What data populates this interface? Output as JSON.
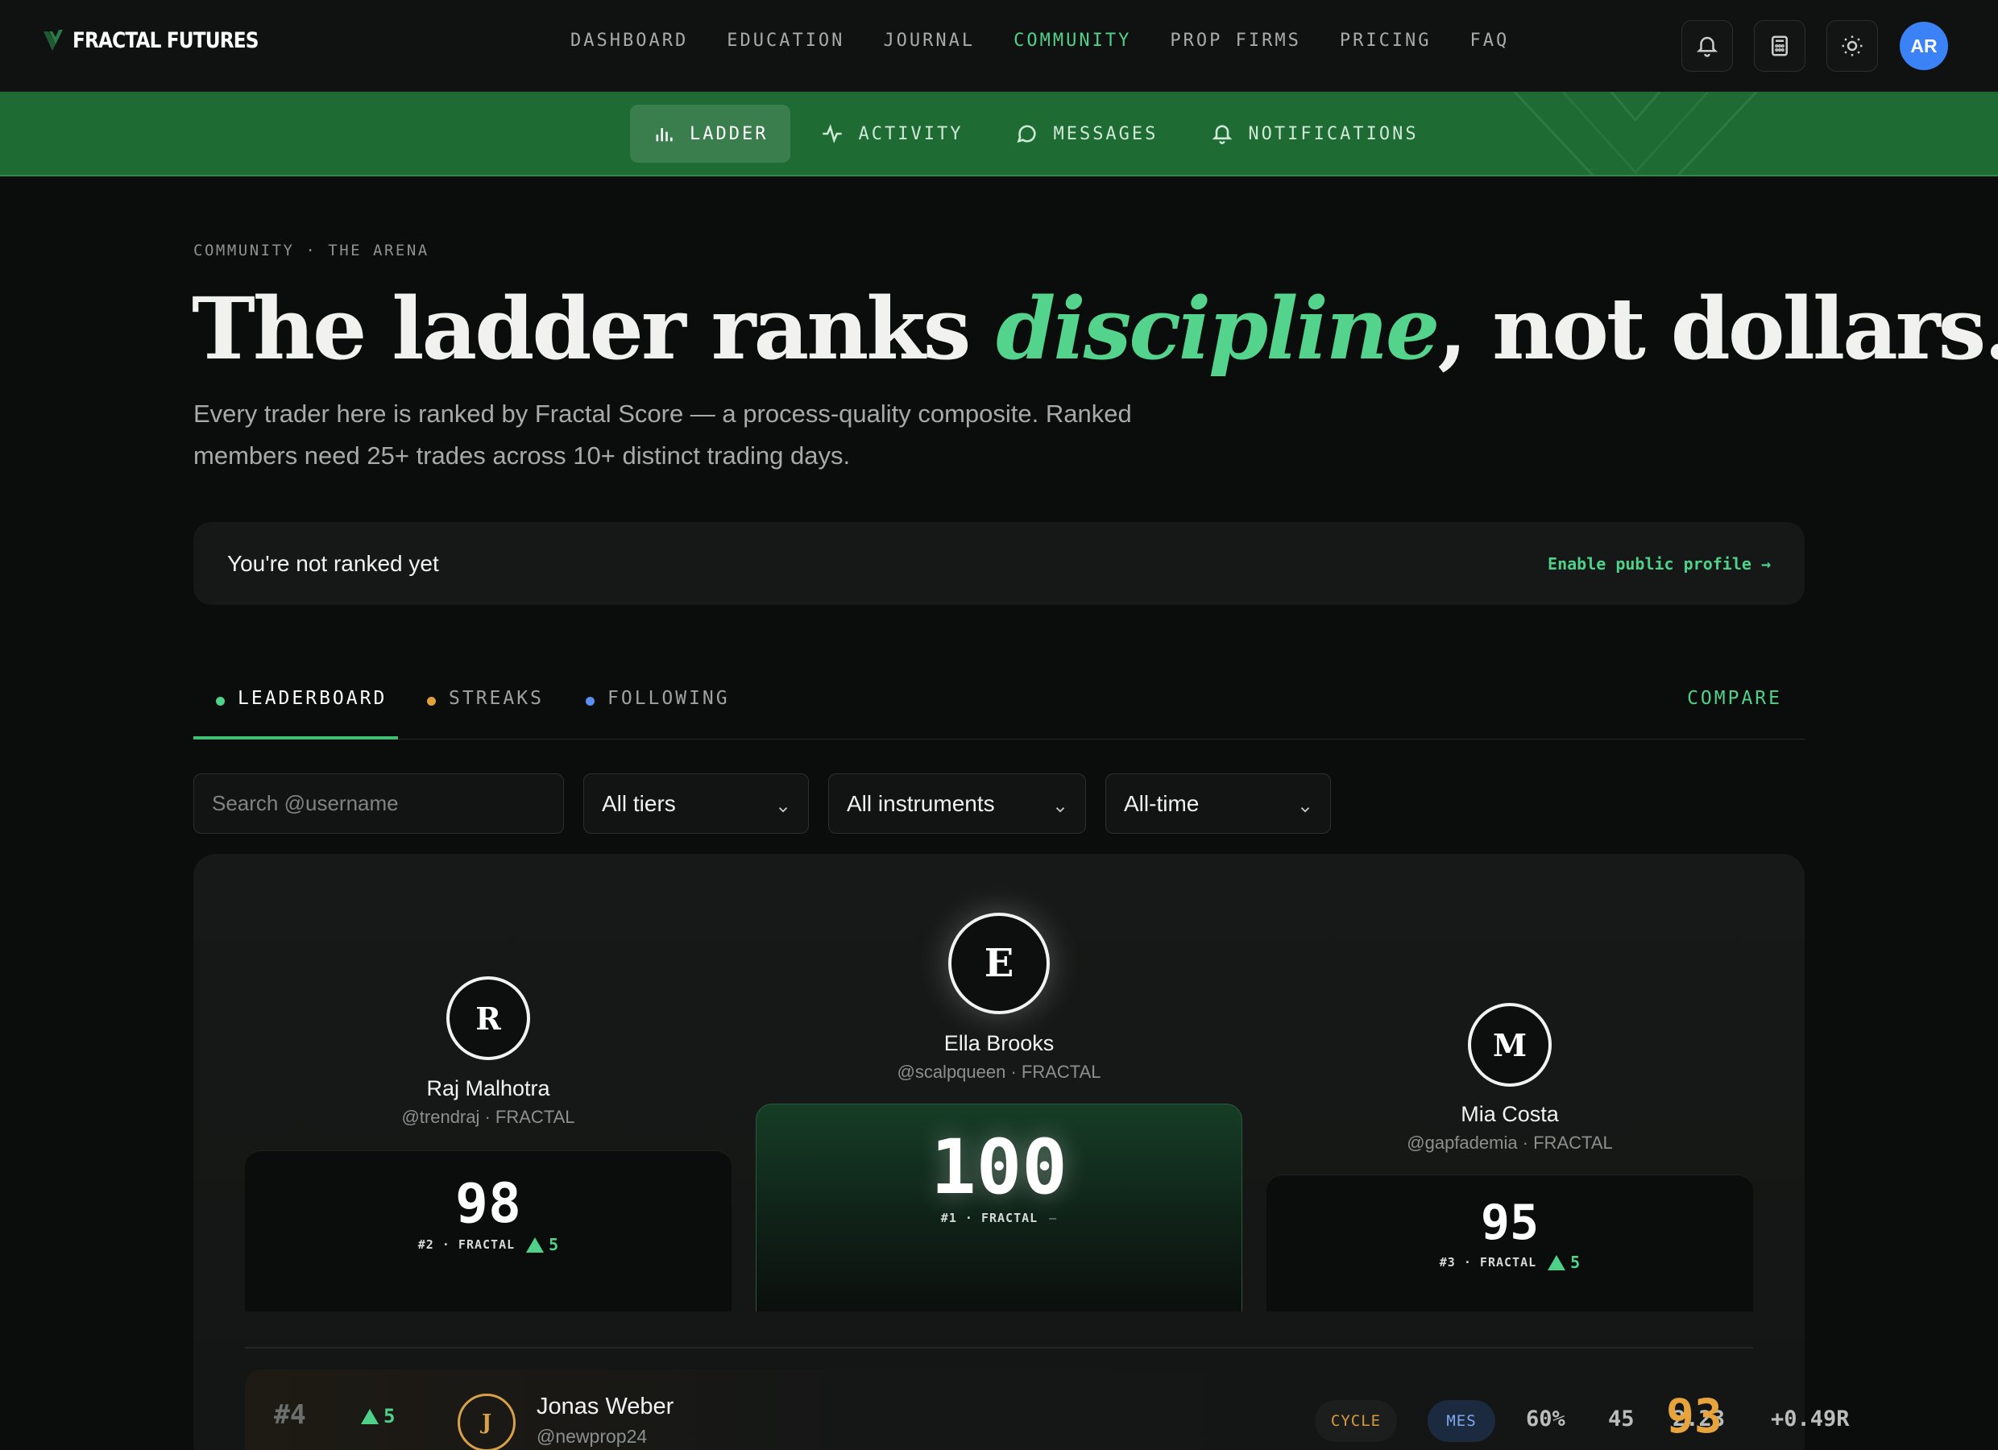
{
  "brand": {
    "name": "FRACTAL FUTURES",
    "logo_icon": "fractal-v-icon"
  },
  "nav": {
    "items": [
      {
        "label": "DASHBOARD",
        "active": false
      },
      {
        "label": "EDUCATION",
        "active": false
      },
      {
        "label": "JOURNAL",
        "active": false
      },
      {
        "label": "COMMUNITY",
        "active": true
      },
      {
        "label": "PROP FIRMS",
        "active": false
      },
      {
        "label": "PRICING",
        "active": false
      },
      {
        "label": "FAQ",
        "active": false
      }
    ],
    "actions": [
      {
        "icon": "bell-icon"
      },
      {
        "icon": "calculator-icon"
      },
      {
        "icon": "sun-icon"
      }
    ],
    "avatar_initials": "AR"
  },
  "subnav": {
    "tabs": [
      {
        "label": "LADDER",
        "icon": "bar-chart-icon",
        "active": true
      },
      {
        "label": "ACTIVITY",
        "icon": "pulse-icon",
        "active": false
      },
      {
        "label": "MESSAGES",
        "icon": "chat-bubble-icon",
        "active": false
      },
      {
        "label": "NOTIFICATIONS",
        "icon": "bell-icon",
        "active": false
      }
    ]
  },
  "hero": {
    "eyebrow": "COMMUNITY · THE ARENA",
    "headline_before": "The ladder ranks ",
    "headline_emphasis": "discipline",
    "headline_after": ", not dollars.",
    "lede": "Every trader here is ranked by Fractal Score — a process-quality composite. Ranked members need 25+ trades across 10+ distinct trading days."
  },
  "rank_banner": {
    "message": "You're not ranked yet",
    "link": "Enable public profile →"
  },
  "leaderboard_tabs": [
    {
      "label": "LEADERBOARD",
      "dot_color": "#4fd18a",
      "active": true
    },
    {
      "label": "STREAKS",
      "dot_color": "#e0a03c",
      "active": false
    },
    {
      "label": "FOLLOWING",
      "dot_color": "#5b8ff0",
      "active": false
    }
  ],
  "compare_label": "COMPARE",
  "filters": {
    "search_placeholder": "Search @username",
    "tier": "All tiers",
    "instrument": "All instruments",
    "period": "All-time"
  },
  "podium": [
    {
      "initial": "R",
      "name": "Raj Malhotra",
      "handle": "@trendraj · FRACTAL",
      "score": "98",
      "meta": "#2 · FRACTAL",
      "delta": "5"
    },
    {
      "initial": "E",
      "name": "Ella Brooks",
      "handle": "@scalpqueen · FRACTAL",
      "score": "100",
      "meta": "#1 · FRACTAL",
      "delta": "—"
    },
    {
      "initial": "M",
      "name": "Mia Costa",
      "handle": "@gapfademia · FRACTAL",
      "score": "95",
      "meta": "#3 · FRACTAL",
      "delta": "5"
    }
  ],
  "rows": [
    {
      "rank": "#4",
      "delta": "5",
      "initial": "J",
      "name": "Jonas Weber",
      "handle": "@newprop24",
      "style_tag": "CYCLE",
      "instrument": "MES",
      "win_rate": "60%",
      "trades": "45",
      "ratio": "2.23",
      "expectancy": "+0.49R",
      "score": "93"
    }
  ],
  "colors": {
    "accent": "#4fd18a",
    "subnav_bg": "#1e6b34",
    "gold": "#e7a43c",
    "avatar_blue": "#3b82f6"
  }
}
